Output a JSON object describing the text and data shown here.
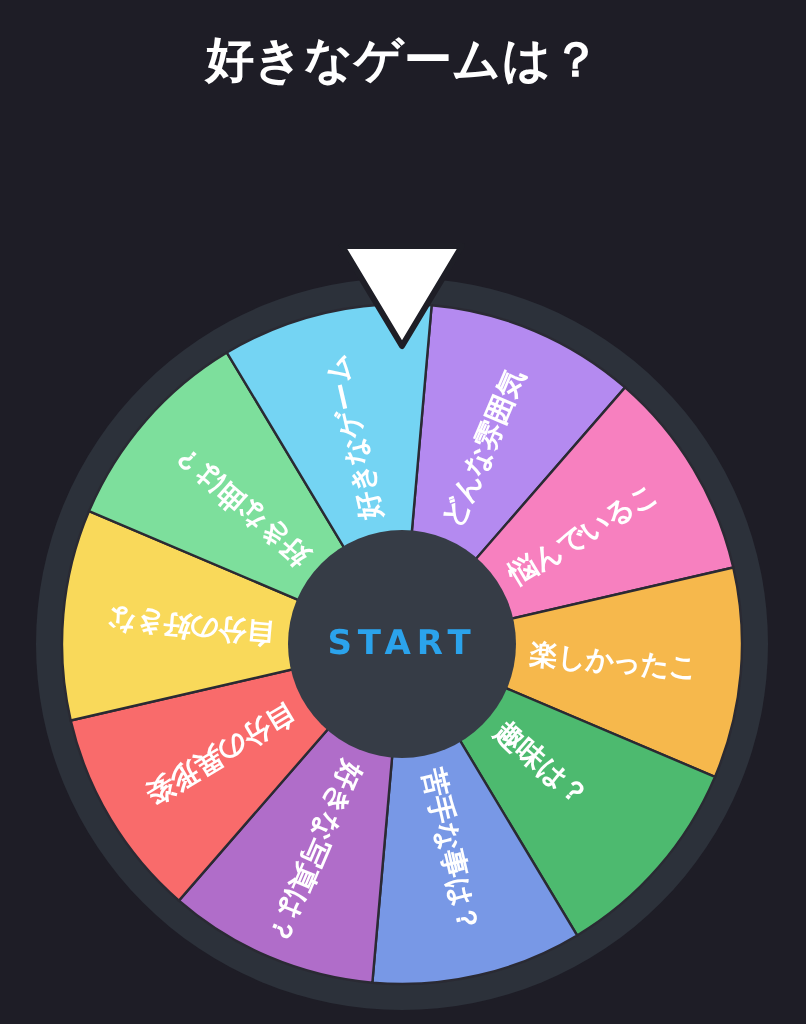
{
  "title": "好きなゲームは？",
  "wheel": {
    "segments": [
      {
        "label": "どんな雰囲気",
        "color": "#b48af0"
      },
      {
        "label": "悩んでいるこ",
        "color": "#f780bf"
      },
      {
        "label": "楽しかったこ",
        "color": "#f6b84c"
      },
      {
        "label": "趣味は？",
        "color": "#4dba6f"
      },
      {
        "label": "苦手な事は？",
        "color": "#7898e6"
      },
      {
        "label": "好きな写真は？",
        "color": "#b06dc9"
      },
      {
        "label": "自分の異形姿",
        "color": "#f96b6b"
      },
      {
        "label": "自分の好きな",
        "color": "#f9d95a"
      },
      {
        "label": "好きな曲は？",
        "color": "#7ddf9c"
      },
      {
        "label": "好きなゲーム",
        "color": "#74d4f3"
      }
    ],
    "start_button": "START"
  }
}
